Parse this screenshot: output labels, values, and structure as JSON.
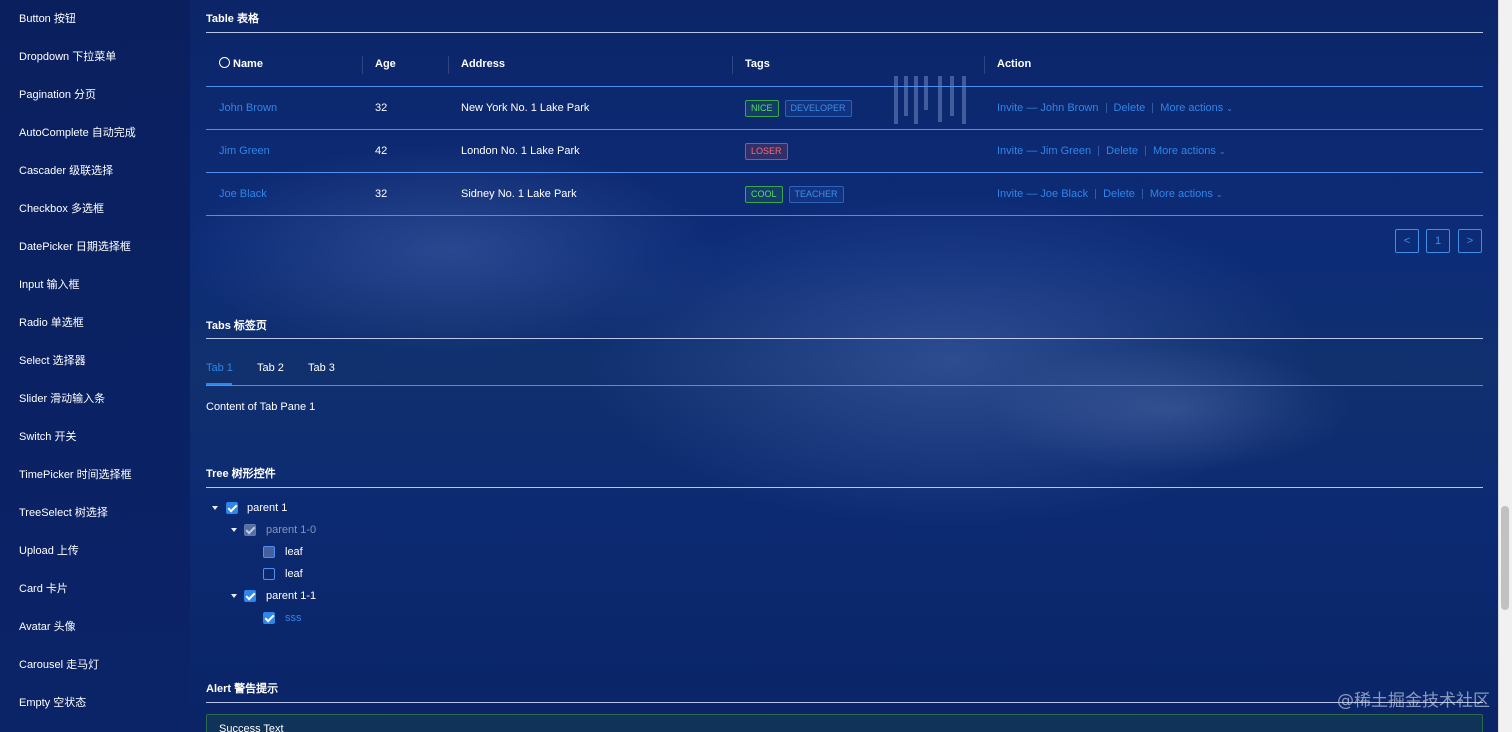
{
  "sidebar": {
    "items": [
      {
        "label": "Button 按钮"
      },
      {
        "label": "Dropdown 下拉菜单"
      },
      {
        "label": "Pagination 分页"
      },
      {
        "label": "AutoComplete 自动完成"
      },
      {
        "label": "Cascader 级联选择"
      },
      {
        "label": "Checkbox 多选框"
      },
      {
        "label": "DatePicker 日期选择框"
      },
      {
        "label": "Input 输入框"
      },
      {
        "label": "Radio 单选框"
      },
      {
        "label": "Select 选择器"
      },
      {
        "label": "Slider 滑动输入条"
      },
      {
        "label": "Switch 开关"
      },
      {
        "label": "TimePicker 时间选择框"
      },
      {
        "label": "TreeSelect 树选择"
      },
      {
        "label": "Upload 上传"
      },
      {
        "label": "Card 卡片"
      },
      {
        "label": "Avatar 头像"
      },
      {
        "label": "Carousel 走马灯"
      },
      {
        "label": "Empty 空状态"
      }
    ]
  },
  "table_section": {
    "title": "Table 表格",
    "columns": {
      "name": "Name",
      "age": "Age",
      "address": "Address",
      "tags": "Tags",
      "action": "Action"
    },
    "rows": [
      {
        "name": "John Brown",
        "age": "32",
        "address": "New York No. 1 Lake Park",
        "tags": [
          {
            "text": "NICE",
            "color": "green"
          },
          {
            "text": "DEVELOPER",
            "color": "blue"
          }
        ],
        "invite": "Invite — John Brown",
        "delete": "Delete",
        "more": "More actions"
      },
      {
        "name": "Jim Green",
        "age": "42",
        "address": "London No. 1 Lake Park",
        "tags": [
          {
            "text": "LOSER",
            "color": "red"
          }
        ],
        "invite": "Invite — Jim Green",
        "delete": "Delete",
        "more": "More actions"
      },
      {
        "name": "Joe Black",
        "age": "32",
        "address": "Sidney No. 1 Lake Park",
        "tags": [
          {
            "text": "COOL",
            "color": "green"
          },
          {
            "text": "TEACHER",
            "color": "blue"
          }
        ],
        "invite": "Invite — Joe Black",
        "delete": "Delete",
        "more": "More actions"
      }
    ],
    "pagination": {
      "prev": "<",
      "page": "1",
      "next": ">"
    }
  },
  "tabs_section": {
    "title": "Tabs 标签页",
    "tabs": [
      {
        "label": "Tab 1"
      },
      {
        "label": "Tab 2"
      },
      {
        "label": "Tab 3"
      }
    ],
    "active_tab": "Tab 1",
    "content": "Content of Tab Pane 1"
  },
  "tree_section": {
    "title": "Tree 树形控件",
    "nodes": [
      {
        "label": "parent 1",
        "state": "checked"
      },
      {
        "label": "parent 1-0",
        "state": "disabled-checked"
      },
      {
        "label": "leaf",
        "state": "unchecked"
      },
      {
        "label": "leaf",
        "state": "unchecked"
      },
      {
        "label": "parent 1-1",
        "state": "checked"
      },
      {
        "label": "sss",
        "state": "checked"
      }
    ]
  },
  "alert_section": {
    "title": "Alert 警告提示",
    "success_text": "Success Text"
  },
  "watermark": "@稀土掘金技术社区",
  "colors": {
    "accent": "#2f86e8",
    "background": "#0b2466",
    "divider": "#4f8ff0"
  }
}
